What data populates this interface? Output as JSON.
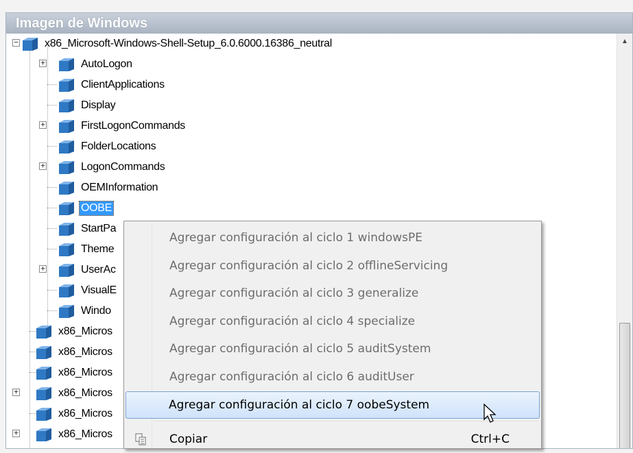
{
  "panel": {
    "title": "Imagen de Windows"
  },
  "tree": {
    "root": "x86_Microsoft-Windows-Shell-Setup_6.0.6000.16386_neutral",
    "children": [
      "AutoLogon",
      "ClientApplications",
      "Display",
      "FirstLogonCommands",
      "FolderLocations",
      "LogonCommands",
      "OEMInformation",
      "OOBE",
      "StartPa",
      "Theme",
      "UserAc",
      "VisualE",
      "Windo"
    ],
    "siblings": [
      "x86_Micros",
      "x86_Micros",
      "x86_Micros",
      "x86_Micros",
      "x86_Micros",
      "x86_Micros"
    ],
    "selected": "OOBE"
  },
  "context_menu": {
    "items": [
      "Agregar configuración al ciclo 1 windowsPE",
      "Agregar configuración al ciclo 2 offlineServicing",
      "Agregar configuración al ciclo 3 generalize",
      "Agregar configuración al ciclo 4 specialize",
      "Agregar configuración al ciclo 5 auditSystem",
      "Agregar configuración al ciclo 6 auditUser",
      "Agregar configuración al ciclo 7 oobeSystem"
    ],
    "copy": {
      "label": "Copiar",
      "shortcut": "Ctrl+C"
    }
  },
  "colors": {
    "selection": "#3399ff",
    "menu_highlight": "#cfe3fb",
    "header": "#a9b3c1"
  },
  "icons": {
    "node": "component-cube-icon",
    "copy": "copy-icon",
    "cursor": "mouse-pointer-icon"
  }
}
